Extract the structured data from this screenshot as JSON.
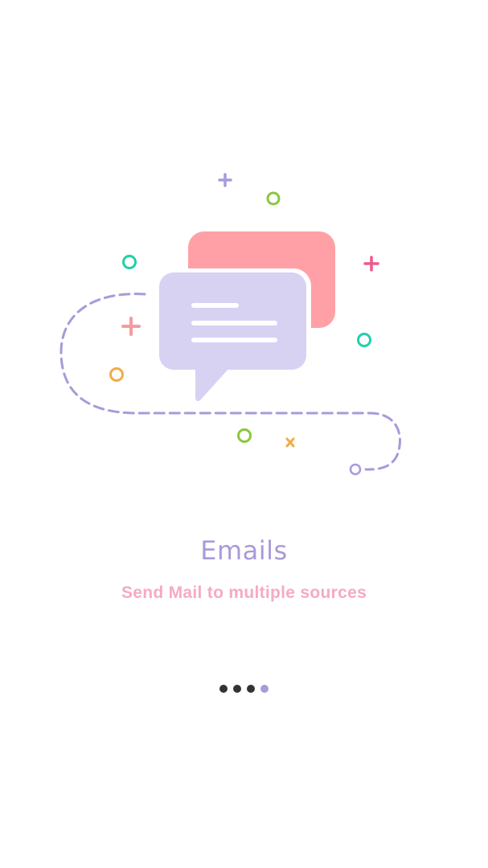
{
  "screen": {
    "title": "Emails",
    "subtitle": "Send Mail to multiple sources"
  },
  "illustration": {
    "icon": "chat-bubbles-icon"
  },
  "pagination": {
    "total_pages": 4,
    "current_page": 4
  },
  "colors": {
    "title": "#a99ad9",
    "subtitle": "#f6a9c6",
    "bubble_back": "#ffa0a7",
    "bubble_front": "#d7d1f2",
    "dashed_path": "#a99ad9",
    "dot_inactive": "#333333",
    "dot_active": "#a99ad9",
    "accent_teal": "#20d0a8",
    "accent_green": "#8cc63f",
    "accent_orange": "#f0ad44",
    "accent_pink": "#ee5a8a",
    "accent_coral": "#f79aa0"
  }
}
